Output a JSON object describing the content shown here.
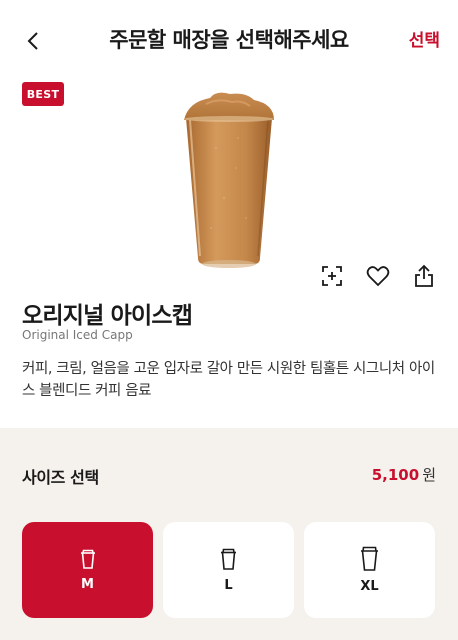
{
  "header": {
    "title": "주문할 매장을 선택해주세요",
    "select_label": "선택",
    "back_icon": "chevron-left-icon"
  },
  "badge": {
    "label": "BEST"
  },
  "product": {
    "name": "오리지널 아이스캡",
    "name_en": "Original Iced Capp",
    "description": "커피, 크림, 얼음을 고운 입자로 갈아 만든 시원한 팀홀튼 시그니처 아이스 블렌디드 커피 음료"
  },
  "actions": {
    "icons": [
      "zoom-icon",
      "heart-icon",
      "share-icon"
    ]
  },
  "size": {
    "label": "사이즈 선택",
    "price": "5,100",
    "price_unit": "원",
    "options": [
      {
        "label": "M",
        "selected": true
      },
      {
        "label": "L",
        "selected": false
      },
      {
        "label": "XL",
        "selected": false
      }
    ]
  },
  "colors": {
    "accent": "#c8102e",
    "panel_bg": "#f5f1ec"
  }
}
